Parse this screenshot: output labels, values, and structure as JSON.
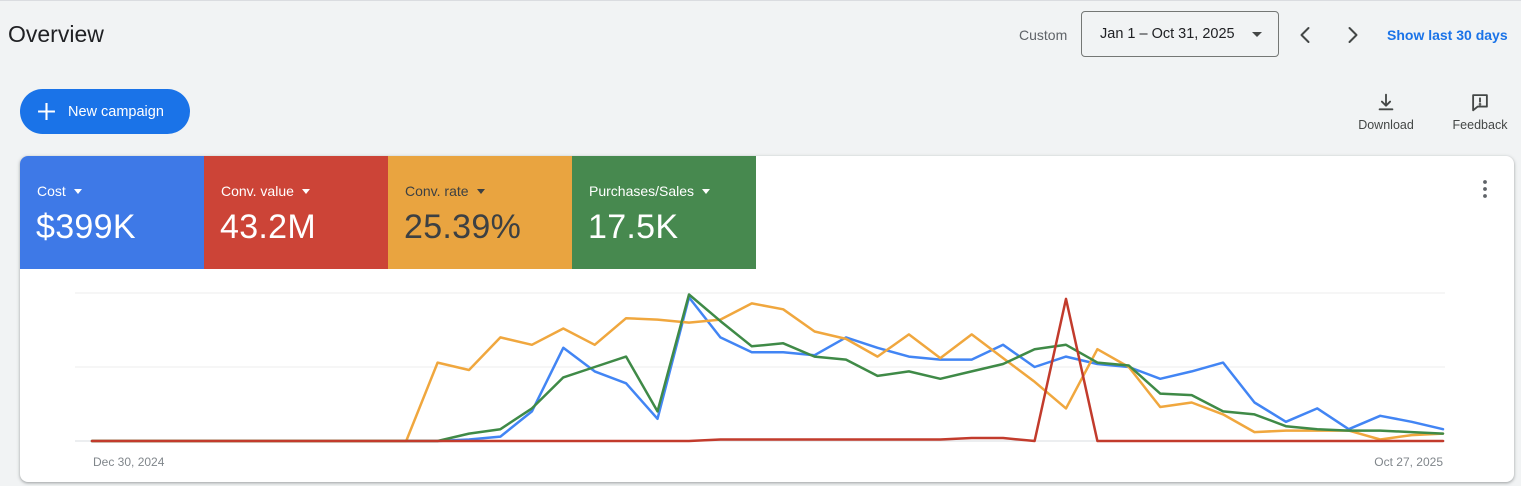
{
  "page": {
    "title": "Overview"
  },
  "date_bar": {
    "mode_label": "Custom",
    "range_value": "Jan 1 – Oct 31, 2025",
    "show_last_link": "Show last 30 days"
  },
  "actions": {
    "new_campaign_label": "New campaign",
    "download_label": "Download",
    "feedback_label": "Feedback"
  },
  "colors": {
    "accent_blue": "#1a73e8",
    "link_blue": "#1a73e8"
  },
  "scorecards": [
    {
      "label": "Cost",
      "value": "$399K",
      "bg": "#3e79e7",
      "fg": "#ffffff"
    },
    {
      "label": "Conv. value",
      "value": "43.2M",
      "bg": "#cc4437",
      "fg": "#ffffff"
    },
    {
      "label": "Conv. rate",
      "value": "25.39%",
      "bg": "#e9a440",
      "fg": "#3c4043"
    },
    {
      "label": "Purchases/Sales",
      "value": "17.5K",
      "bg": "#47894f",
      "fg": "#ffffff"
    }
  ],
  "chart_data": {
    "type": "line",
    "x_unit": "week",
    "n_points": 44,
    "x_axis": {
      "start_label": "Dec 30, 2024",
      "end_label": "Oct 27, 2025"
    },
    "ylim": [
      0,
      100
    ],
    "y_note": "values are percent of top gridline (no y tick labels shown)",
    "grid": true,
    "grid_color": "#ececec",
    "baseline_color": "#dadce0",
    "legend": "none (series correspond to colored scorecards above)",
    "series": [
      {
        "name": "Cost",
        "color": "#4285f4",
        "values": [
          0,
          0,
          0,
          0,
          0,
          0,
          0,
          0,
          0,
          0,
          0,
          0,
          1,
          3,
          20,
          63,
          47,
          39,
          15,
          97,
          70,
          60,
          60,
          58,
          70,
          63,
          57,
          55,
          55,
          65,
          50,
          57,
          52,
          50,
          42,
          47,
          53,
          26,
          13,
          22,
          8,
          17,
          13,
          8
        ]
      },
      {
        "name": "Conv. rate",
        "color": "#f0a73e",
        "values": [
          0,
          0,
          0,
          0,
          0,
          0,
          0,
          0,
          0,
          0,
          0,
          53,
          48,
          70,
          65,
          76,
          65,
          83,
          82,
          80,
          82,
          93,
          89,
          74,
          69,
          57,
          72,
          56,
          72,
          56,
          40,
          22,
          62,
          50,
          23,
          26,
          18,
          6,
          7,
          7,
          7,
          1,
          4,
          5
        ]
      },
      {
        "name": "Purchases/Sales",
        "color": "#3f8a47",
        "values": [
          0,
          0,
          0,
          0,
          0,
          0,
          0,
          0,
          0,
          0,
          0,
          0,
          5,
          8,
          22,
          43,
          50,
          57,
          20,
          99,
          81,
          64,
          66,
          57,
          55,
          44,
          47,
          42,
          47,
          52,
          62,
          65,
          53,
          51,
          32,
          31,
          20,
          18,
          10,
          8,
          7,
          7,
          6,
          5
        ]
      },
      {
        "name": "Conv. value",
        "color": "#c23b2c",
        "values": [
          0,
          0,
          0,
          0,
          0,
          0,
          0,
          0,
          0,
          0,
          0,
          0,
          0,
          0,
          0,
          0,
          0,
          0,
          0,
          0,
          1,
          1,
          1,
          1,
          1,
          1,
          1,
          1,
          2,
          2,
          0,
          96,
          0,
          0,
          0,
          0,
          0,
          0,
          0,
          0,
          0,
          0,
          0,
          0
        ]
      }
    ]
  }
}
